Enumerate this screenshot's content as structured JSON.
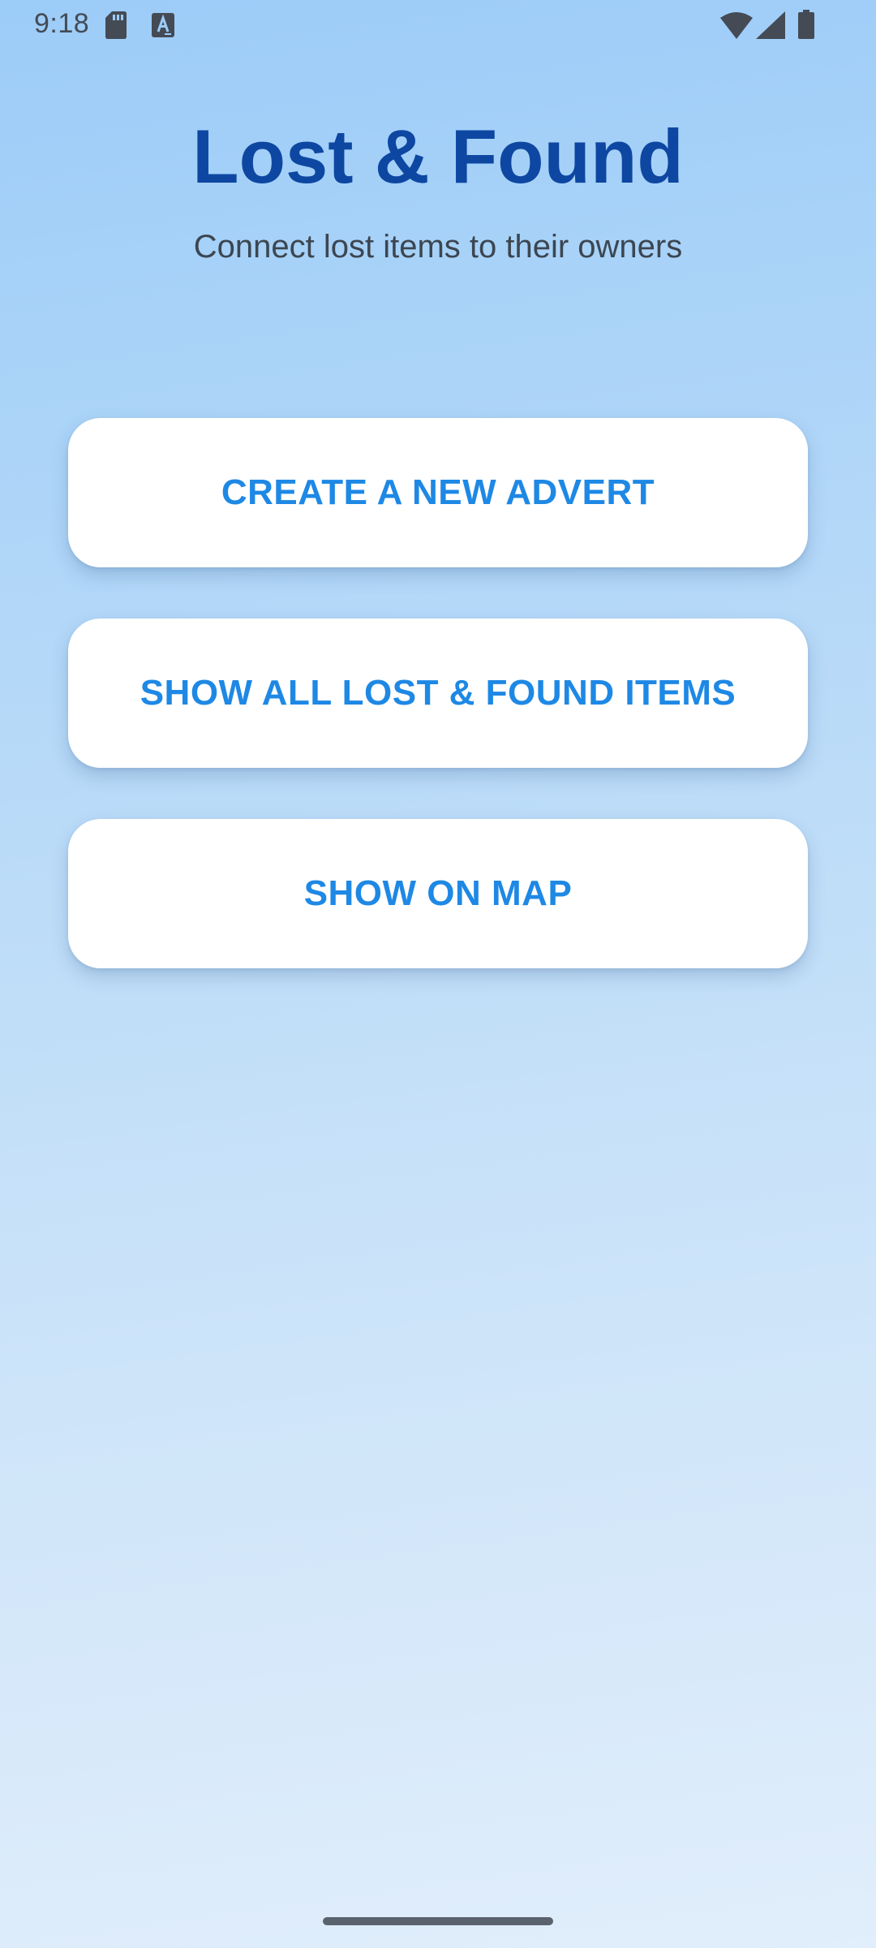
{
  "status_bar": {
    "time": "9:18",
    "icons": [
      "sd-card-icon",
      "text-a-icon",
      "wifi-icon",
      "signal-icon",
      "battery-icon"
    ]
  },
  "header": {
    "title": "Lost & Found",
    "subtitle": "Connect lost items to their owners"
  },
  "buttons": {
    "create_advert": "CREATE A NEW ADVERT",
    "show_all_items": "SHOW ALL LOST & FOUND ITEMS",
    "show_on_map": "SHOW ON MAP"
  },
  "colors": {
    "title": "#0d47a1",
    "button_text": "#1e88e5",
    "button_background": "#ffffff",
    "background_top": "#9cccf8",
    "background_bottom": "#e1eefb"
  }
}
